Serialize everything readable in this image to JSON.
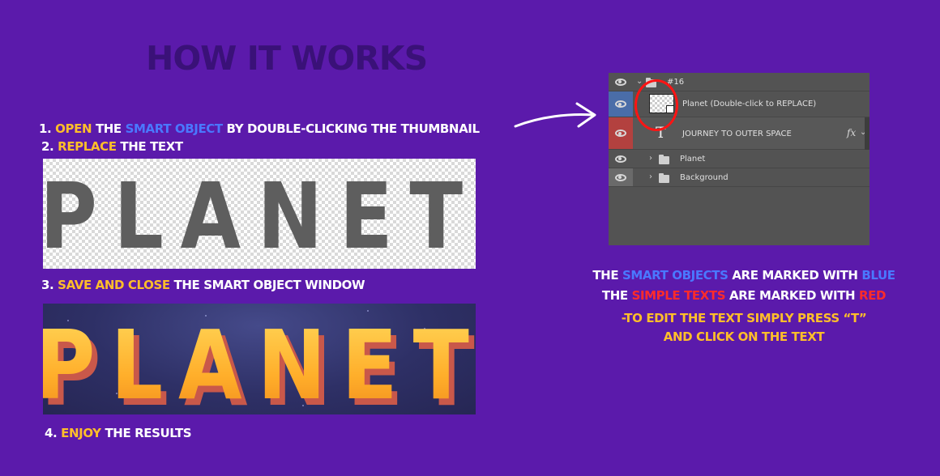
{
  "title": "HOW IT WORKS",
  "colors": {
    "background": "#5b1aab",
    "yellow": "#ffbe2a",
    "blue": "#4a78ff",
    "red": "#ff2b2b",
    "panel": "#535353",
    "blue_row": "#4a6da8",
    "red_row": "#b3413f"
  },
  "steps": {
    "s1": {
      "num": "1. ",
      "w1": "OPEN",
      "w2": " THE ",
      "w3": "SMART OBJECT",
      "w4": "  BY DOUBLE-CLICKING THE THUMBNAIL"
    },
    "s2": {
      "num": "2. ",
      "w1": "REPLACE",
      "w2": " THE TEXT"
    },
    "s3": {
      "num": "3. ",
      "w1": "SAVE AND CLOSE",
      "w2": " THE SMART OBJECT WINDOW"
    },
    "s4": {
      "num": "4. ",
      "w1": "ENJOY",
      "w2": " THE RESULTS"
    }
  },
  "preview_plain": {
    "text": "PLANET"
  },
  "preview_result": {
    "text": "PLANET"
  },
  "layers": {
    "group": {
      "name": "#16",
      "icon": "folder-icon"
    },
    "items": [
      {
        "name": "Planet (Double-click to REPLACE)",
        "kind": "smart-object",
        "marker": "blue"
      },
      {
        "name": "JOURNEY TO OUTER SPACE",
        "kind": "text",
        "marker": "red",
        "fx": "fx"
      },
      {
        "name": "Planet",
        "kind": "folder"
      },
      {
        "name": "Background",
        "kind": "folder"
      }
    ]
  },
  "notes": {
    "l1": {
      "a": "THE ",
      "b": "SMART OBJECTS",
      "c": " ARE MARKED WITH ",
      "d": "BLUE"
    },
    "l2": {
      "a": "THE ",
      "b": "SIMPLE TEXTS",
      "c": " ARE MARKED WITH ",
      "d": "RED"
    },
    "l3": "-TO EDIT THE TEXT SIMPLY PRESS “T”",
    "l4": "AND CLICK ON THE TEXT"
  }
}
